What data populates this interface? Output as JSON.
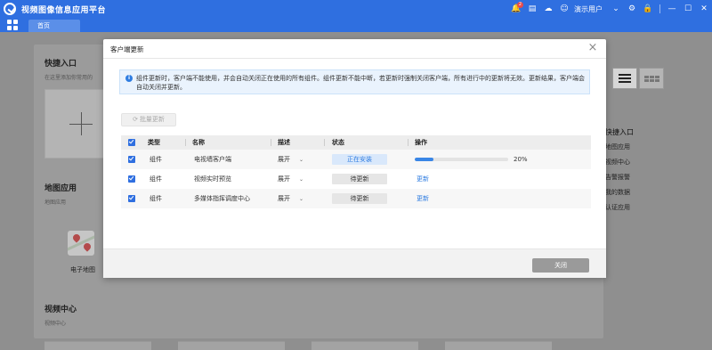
{
  "app": {
    "title": "视频图像信息应用平台",
    "user_label": "演示用户",
    "notification_count": "2"
  },
  "tabs": {
    "home_label": "首页"
  },
  "background": {
    "quick_entry_title": "快捷入口",
    "quick_entry_sub": "在这里添加你常用的",
    "map_app_title": "地图应用",
    "map_app_sub": "地图应用",
    "map_item_label": "电子地图",
    "video_center_title": "视频中心",
    "video_center_sub": "视频中心",
    "right_panel": {
      "title": "快捷入口",
      "items": [
        "地图应用",
        "视频中心",
        "告警报警",
        "我的数据",
        "认证应用"
      ]
    }
  },
  "modal": {
    "title": "客户端更新",
    "notice": "组件更新时，客户端不能使用，并会自动关闭正在使用的所有组件。组件更新不能中断，若更新时强制关闭客户端，所有进行中的更新将无效。更新结果，客户端会自动关闭并更新。",
    "batch_update_label": "批量更新",
    "columns": {
      "type": "类型",
      "name": "名称",
      "description": "描述",
      "status": "状态",
      "action": "操作"
    },
    "rows": [
      {
        "type": "组件",
        "name": "电视墙客户端",
        "description": "展开",
        "status": "正在安装",
        "progress_percent": 20,
        "progress_label": "20%",
        "action": ""
      },
      {
        "type": "组件",
        "name": "视频实时预览",
        "description": "展开",
        "status": "待更新",
        "action": "更新"
      },
      {
        "type": "组件",
        "name": "多媒体指挥调度中心",
        "description": "展开",
        "status": "待更新",
        "action": "更新"
      }
    ],
    "close_label": "关闭"
  },
  "colors": {
    "brand": "#2f6fe0",
    "link": "#2f7de1",
    "progress": "#3a86e6"
  }
}
